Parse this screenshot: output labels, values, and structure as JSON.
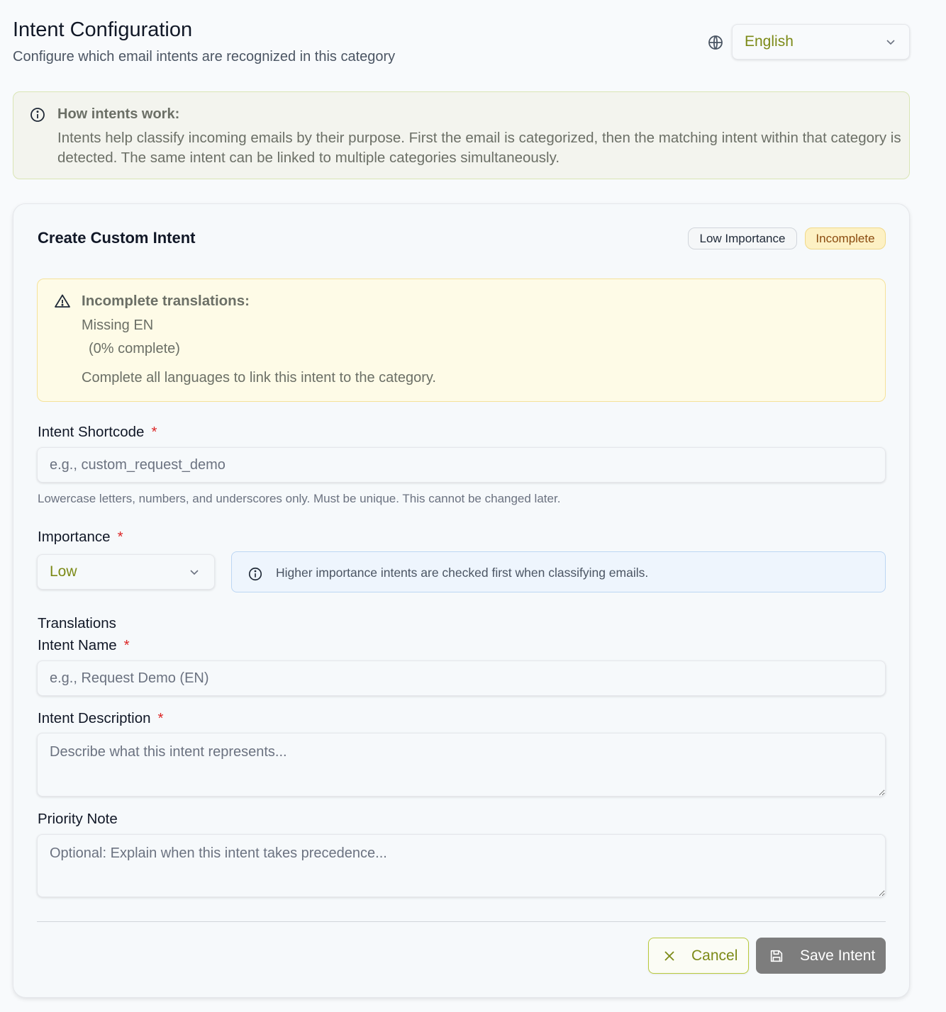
{
  "header": {
    "title": "Intent Configuration",
    "subtitle": "Configure which email intents are recognized in this category",
    "language_select": {
      "value": "English",
      "icon": "globe-icon"
    }
  },
  "info_box": {
    "title": "How intents work:",
    "body": "Intents help classify incoming emails by their purpose. First the email is categorized, then the matching intent within that category is detected. The same intent can be linked to multiple categories simultaneously."
  },
  "card": {
    "title": "Create Custom Intent",
    "badges": {
      "importance": "Low Importance",
      "status": "Incomplete"
    },
    "warning": {
      "title": "Incomplete translations:",
      "missing": "Missing EN",
      "progress": "(0% complete)",
      "note": "Complete all languages to link this intent to the category."
    },
    "shortcode": {
      "label": "Intent Shortcode",
      "required": "*",
      "placeholder": "e.g., custom_request_demo",
      "help": "Lowercase letters, numbers, and underscores only. Must be unique. This cannot be changed later."
    },
    "importance": {
      "label": "Importance",
      "required": "*",
      "value": "Low",
      "hint": "Higher importance intents are checked first when classifying emails."
    },
    "translations": {
      "section_label": "Translations",
      "name_label": "Intent Name",
      "name_required": "*",
      "name_placeholder": "e.g., Request Demo (EN)",
      "description_label": "Intent Description",
      "description_required": "*",
      "description_placeholder": "Describe what this intent represents...",
      "priority_label": "Priority Note",
      "priority_placeholder": "Optional: Explain when this intent takes precedence..."
    },
    "actions": {
      "cancel": "Cancel",
      "save": "Save Intent"
    }
  },
  "colors": {
    "accent": "#7c8a17",
    "info_bg": "#f3f4ee",
    "warning_bg": "#fefbe7",
    "hint_bg": "#eef5fd",
    "required": "#dc2626",
    "save_disabled": "#7d7d7d"
  }
}
